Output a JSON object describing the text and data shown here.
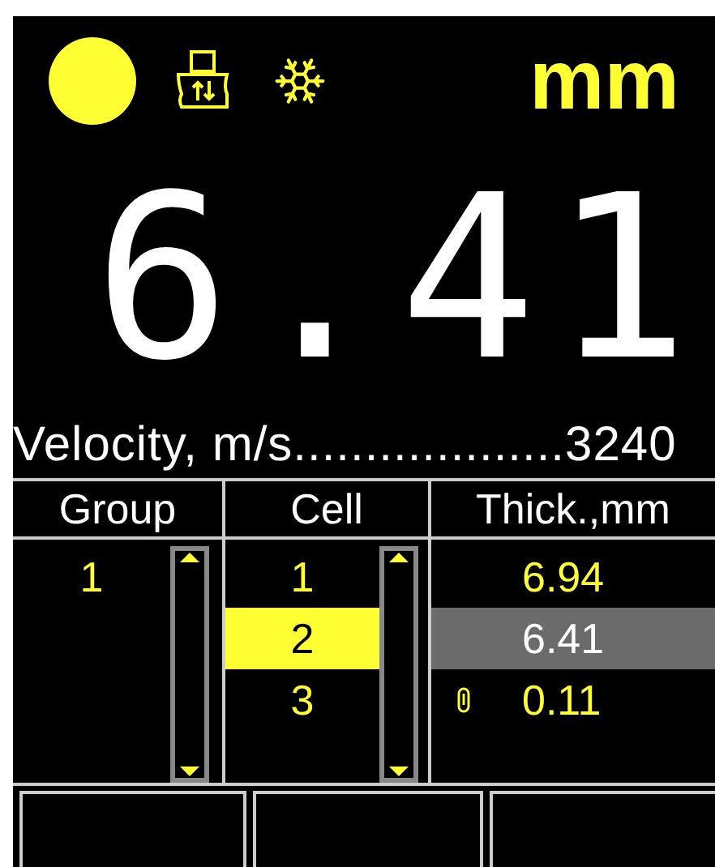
{
  "status": {
    "indicator_on": true,
    "unit": "mm"
  },
  "reading": "6.41",
  "velocity": "Velocity, m/s...................3240",
  "table": {
    "columns": [
      "Group",
      "Cell",
      "Thick.,mm"
    ],
    "groups": [
      {
        "label": "1",
        "selected": false
      }
    ],
    "cells": [
      {
        "label": "1",
        "selected": false
      },
      {
        "label": "2",
        "selected": true
      },
      {
        "label": "3",
        "selected": false
      }
    ],
    "thicknesses": [
      {
        "value": "6.94",
        "selected": false,
        "attached": false
      },
      {
        "value": "6.41",
        "selected": true,
        "attached": false
      },
      {
        "value": "0.11",
        "selected": false,
        "attached": true
      }
    ]
  }
}
